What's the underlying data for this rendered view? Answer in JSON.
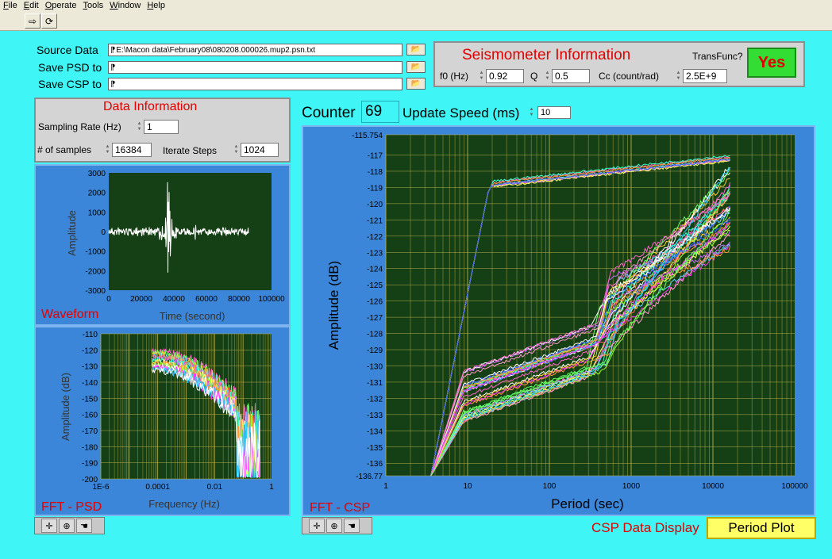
{
  "menu": [
    "File",
    "Edit",
    "Operate",
    "Tools",
    "Window",
    "Help"
  ],
  "toolbar": {
    "run_icon": "run-arrow-icon",
    "run_continuous_icon": "run-continuously-icon"
  },
  "files": {
    "source_label": "Source Data",
    "source_value": "E:\\Macon data\\February08\\080208.000026.mup2.psn.txt",
    "psd_label": "Save PSD to",
    "psd_value": "",
    "csp_label": "Save CSP to",
    "csp_value": ""
  },
  "seismometer": {
    "title": "Seismometer Information",
    "transfunc_label": "TransFunc?",
    "transfunc_value": "Yes",
    "f0_label": "f0 (Hz)",
    "f0_value": "0.92",
    "q_label": "Q",
    "q_value": "0.5",
    "cc_label": "Cc (count/rad)",
    "cc_value": "2.5E+9"
  },
  "data_info": {
    "title": "Data Information",
    "sampling_label": "Sampling Rate (Hz)",
    "sampling_value": "1",
    "samples_label": "# of samples",
    "samples_value": "16384",
    "iterate_label": "Iterate Steps",
    "iterate_value": "1024"
  },
  "counter": {
    "label": "Counter",
    "value": "69",
    "speed_label": "Update Speed (ms)",
    "speed_value": "10"
  },
  "waveform": {
    "title": "Waveform",
    "ylabel": "Amplitude",
    "xlabel": "Time (second)",
    "yticks": [
      "3000",
      "2000",
      "1000",
      "0",
      "-1000",
      "-2000",
      "-3000"
    ],
    "xticks": [
      "0",
      "20000",
      "40000",
      "60000",
      "80000",
      "100000"
    ]
  },
  "psd": {
    "title": "FFT - PSD",
    "ylabel": "Amplitude (dB)",
    "xlabel": "Frequency (Hz)",
    "yticks": [
      "-110",
      "-120",
      "-130",
      "-140",
      "-150",
      "-160",
      "-170",
      "-180",
      "-190",
      "-200"
    ],
    "xticks": [
      "1E-6",
      "0.0001",
      "0.01",
      "1"
    ]
  },
  "csp": {
    "title": "FFT - CSP",
    "ylabel": "Amplitude (dB)",
    "xlabel": "Period (sec)",
    "yticks": [
      "-115.754",
      "-117",
      "-118",
      "-119",
      "-120",
      "-121",
      "-122",
      "-123",
      "-124",
      "-125",
      "-126",
      "-127",
      "-128",
      "-129",
      "-130",
      "-131",
      "-132",
      "-133",
      "-134",
      "-135",
      "-136",
      "-136.77"
    ],
    "xticks": [
      "1",
      "10",
      "100",
      "1000",
      "10000",
      "100000"
    ]
  },
  "csp_display": {
    "label": "CSP Data Display",
    "value": "Period Plot"
  },
  "graph_tools": [
    "cursor-cross-icon",
    "zoom-icon",
    "pan-hand-icon"
  ],
  "colors": {
    "background": "#3ff5f5",
    "panel_blue": "#3b86d8",
    "plot_bg": "#1a4d1a",
    "grid": "#b8b04a",
    "title_red": "#e00000",
    "yes_green": "#33dd33",
    "period_yellow": "#ffff66"
  }
}
